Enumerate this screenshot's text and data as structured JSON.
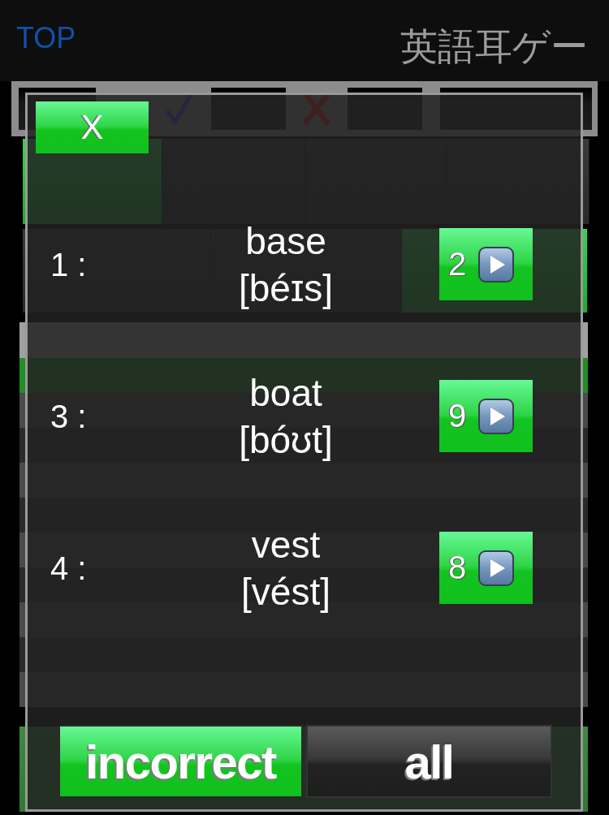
{
  "nav_bar": {
    "back_link": "TOP",
    "title": "英語耳ゲー"
  },
  "scope_tabs": [
    {
      "selected": true
    },
    {
      "selected": false
    },
    {
      "selected": false
    },
    {
      "selected": false
    }
  ],
  "period_tabs": [
    {
      "selected": false
    },
    {
      "selected": false
    },
    {
      "selected": true
    }
  ],
  "ranking_table": {
    "rows": [
      {
        "highlighted": true
      },
      {
        "highlighted": false
      },
      {
        "highlighted": false
      },
      {
        "highlighted": false
      },
      {
        "highlighted": false
      },
      {
        "highlighted": false
      },
      {
        "highlighted": false
      },
      {
        "highlighted": false
      },
      {
        "highlighted": false
      },
      {
        "highlighted": false
      }
    ]
  },
  "dialog": {
    "close_button": "X",
    "words": [
      {
        "number": "1 :",
        "word": "base",
        "pronunciation": "[béɪs]",
        "count": "2"
      },
      {
        "number": "3 :",
        "word": "boat",
        "pronunciation": "[bóʊt]",
        "count": "9"
      },
      {
        "number": "4 :",
        "word": "vest",
        "pronunciation": "[vést]",
        "count": "8"
      }
    ],
    "filter": [
      {
        "label": "incorrect",
        "selected": true
      },
      {
        "label": "all",
        "selected": false
      }
    ]
  }
}
